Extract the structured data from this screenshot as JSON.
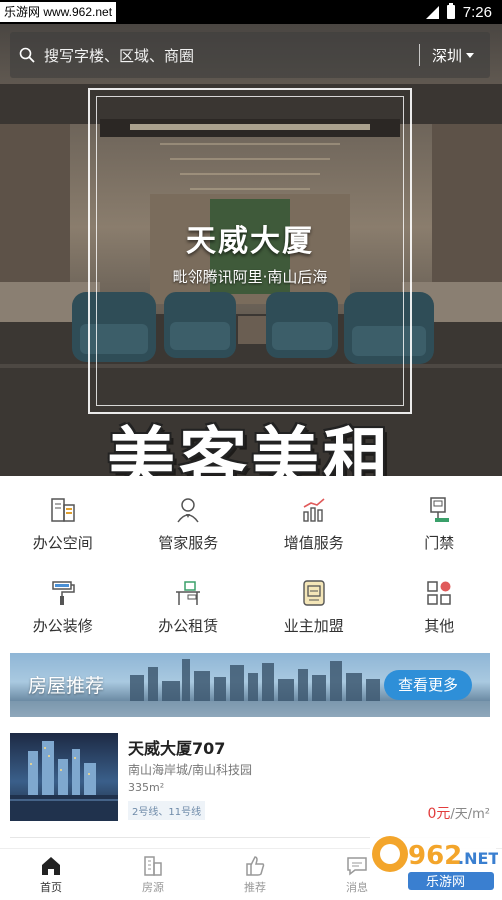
{
  "status_bar": {
    "watermark": "乐游网 www.962.net",
    "time": "7:26"
  },
  "search": {
    "placeholder": "搜写字楼、区域、商圈",
    "city": "深圳",
    "icons": [
      "search-icon",
      "chevron-down-icon"
    ]
  },
  "hero": {
    "title": "天威大厦",
    "subtitle": "毗邻腾讯阿里·南山后海",
    "slogan": "美客美租"
  },
  "services": [
    {
      "label": "办公空间",
      "icon": "office-space-icon"
    },
    {
      "label": "管家服务",
      "icon": "butler-icon"
    },
    {
      "label": "增值服务",
      "icon": "growth-chart-icon"
    },
    {
      "label": "门禁",
      "icon": "access-control-icon"
    },
    {
      "label": "办公装修",
      "icon": "paint-roller-icon"
    },
    {
      "label": "办公租赁",
      "icon": "desk-icon"
    },
    {
      "label": "业主加盟",
      "icon": "owner-join-icon"
    },
    {
      "label": "其他",
      "icon": "grid-more-icon"
    }
  ],
  "recommend": {
    "title": "房屋推荐",
    "more_label": "查看更多"
  },
  "listing": {
    "name": "天威大厦707",
    "area": "南山海岸城/南山科技园",
    "size": "335m²",
    "transit_tag": "2号线、11号线",
    "price_value": "0元",
    "price_unit": "/天/m²"
  },
  "nav": [
    {
      "label": "首页",
      "icon": "home-icon",
      "active": true
    },
    {
      "label": "房源",
      "icon": "building-icon",
      "active": false
    },
    {
      "label": "推荐",
      "icon": "thumbs-up-icon",
      "active": false
    },
    {
      "label": "消息",
      "icon": "message-icon",
      "active": false
    }
  ],
  "watermark_logo": {
    "text": "962.NET",
    "sub": "乐游网"
  },
  "colors": {
    "accent": "#2e8fd8",
    "price": "#e23c3c",
    "icon_gray": "#666666",
    "icon_red": "#e05a5a",
    "icon_green": "#3aa06a"
  }
}
